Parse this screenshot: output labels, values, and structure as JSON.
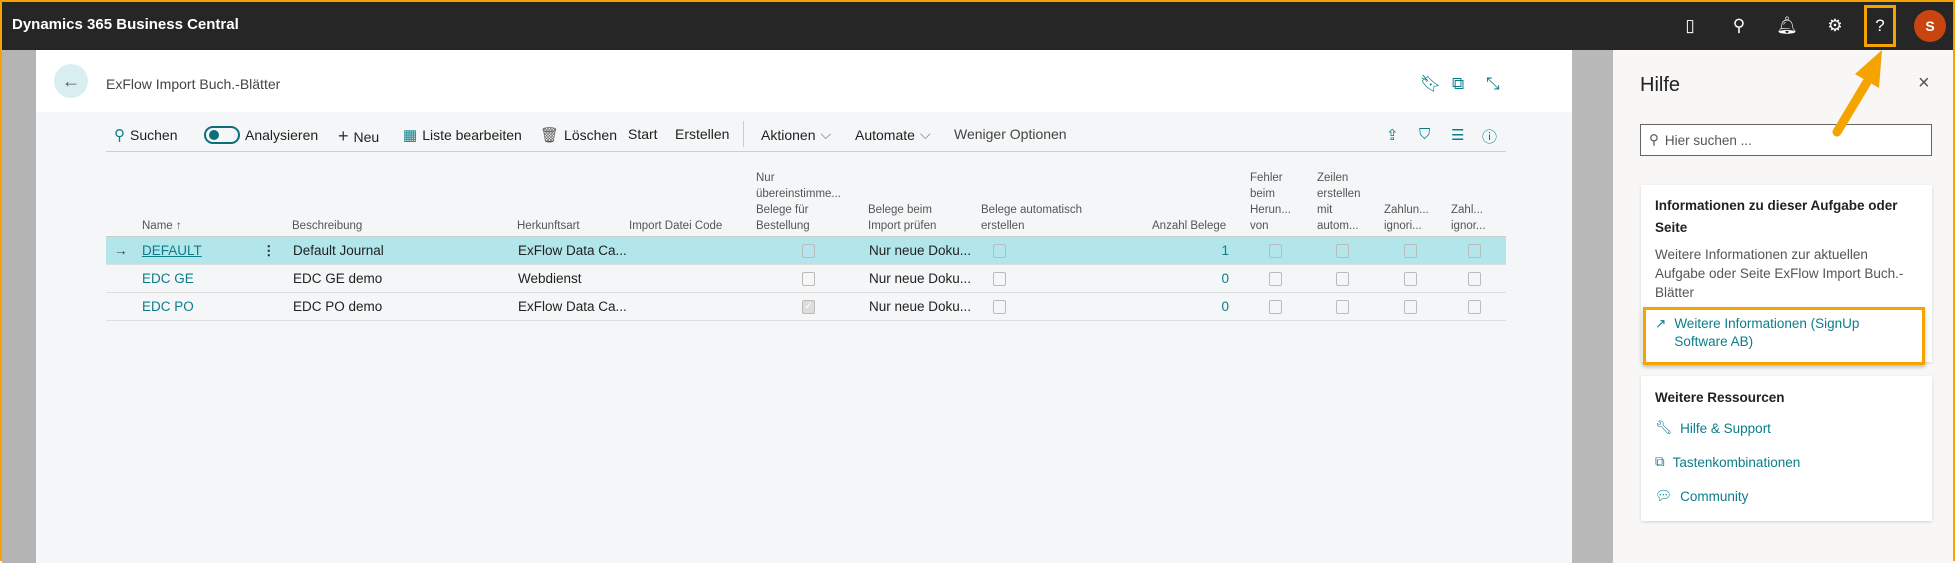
{
  "app": {
    "title": "Dynamics 365 Business Central",
    "avatar_initial": "S"
  },
  "page": {
    "title": "ExFlow Import Buch.-Blätter"
  },
  "toolbar": {
    "search": "Suchen",
    "analyze": "Analysieren",
    "new": "Neu",
    "edit_list": "Liste bearbeiten",
    "delete": "Löschen",
    "start": "Start",
    "create": "Erstellen",
    "actions": "Aktionen",
    "automate": "Automate",
    "fewer_options": "Weniger Optionen"
  },
  "columns": {
    "name": "Name",
    "sort": "↑",
    "description": "Beschreibung",
    "source_type": "Herkunftsart",
    "import_code": "Import Datei Code",
    "only_matching": [
      "Nur",
      "übereinstimme...",
      "Belege für",
      "Bestellung"
    ],
    "check_on_import": [
      "Belege beim",
      "Import prüfen"
    ],
    "auto_create": [
      "Belege automatisch",
      "erstellen"
    ],
    "doc_count": "Anzahl Belege",
    "error_download": [
      "Fehler",
      "beim",
      "Herun...",
      "von"
    ],
    "create_lines": [
      "Zeilen",
      "erstellen",
      "mit",
      "autom..."
    ],
    "payment_ignore1": [
      "Zahlun...",
      "ignori..."
    ],
    "payment_ignore2": [
      "Zahl...",
      "ignor..."
    ]
  },
  "rows": [
    {
      "name": "DEFAULT",
      "description": "Default Journal",
      "source_type": "ExFlow Data Ca...",
      "import_code": "",
      "only_matching": false,
      "check_on_import": "Nur neue Doku...",
      "doc_count": "1",
      "selected": true
    },
    {
      "name": "EDC GE",
      "description": "EDC GE demo",
      "source_type": "Webdienst",
      "import_code": "",
      "only_matching": false,
      "check_on_import": "Nur neue Doku...",
      "doc_count": "0",
      "selected": false
    },
    {
      "name": "EDC PO",
      "description": "EDC PO demo",
      "source_type": "ExFlow Data Ca...",
      "import_code": "",
      "only_matching": true,
      "check_on_import": "Nur neue Doku...",
      "doc_count": "0",
      "selected": false
    }
  ],
  "help": {
    "title": "Hilfe",
    "search_placeholder": "Hier suchen ...",
    "info_heading_1": "Informationen zu dieser Aufgabe oder",
    "info_heading_2": "Seite",
    "info_text_1": "Weitere Informationen zur aktuellen",
    "info_text_2": "Aufgabe oder Seite ExFlow Import Buch.-",
    "info_text_3": "Blätter",
    "more_info_link_1": "Weitere Informationen (SignUp",
    "more_info_link_2": "Software AB)",
    "resources_heading": "Weitere Ressourcen",
    "help_support": "Hilfe & Support",
    "shortcuts": "Tastenkombinationen",
    "community": "Community"
  },
  "colors": {
    "accent": "#0b7d8a",
    "highlight": "#f5a300",
    "selected_row": "#b2e6ea",
    "avatar": "#c8450f"
  }
}
